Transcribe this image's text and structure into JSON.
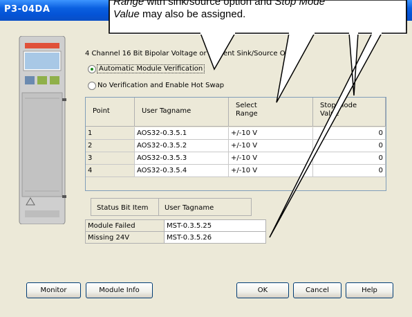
{
  "window": {
    "title": "P3-04DA"
  },
  "module_description": "4 Channel 16 Bit Bipolar Voltage or Current Sink/Source O",
  "verification": {
    "options": [
      {
        "label": "Automatic Module Verification",
        "selected": true
      },
      {
        "label": "No Verification and Enable Hot Swap",
        "selected": false
      }
    ]
  },
  "channels_table": {
    "columns": [
      "Point",
      "User Tagname",
      "Select\nRange",
      "Stop Mode\nValue"
    ],
    "rows": [
      {
        "point": "1",
        "tag": "AOS32-0.3.5.1",
        "range": "+/-10 V",
        "stop": "0"
      },
      {
        "point": "2",
        "tag": "AOS32-0.3.5.2",
        "range": "+/-10 V",
        "stop": "0"
      },
      {
        "point": "3",
        "tag": "AOS32-0.3.5.3",
        "range": "+/-10 V",
        "stop": "0"
      },
      {
        "point": "4",
        "tag": "AOS32-0.3.5.4",
        "range": "+/-10 V",
        "stop": "0"
      }
    ]
  },
  "status_table": {
    "columns": [
      "Status Bit Item",
      "User Tagname"
    ],
    "rows": [
      {
        "item": "Module Failed",
        "tag": "MST-0.3.5.25"
      },
      {
        "item": "Missing 24V",
        "tag": "MST-0.3.5.26"
      }
    ]
  },
  "buttons": {
    "monitor": "Monitor",
    "module_info": "Module Info",
    "ok": "OK",
    "cancel": "Cancel",
    "help": "Help"
  },
  "callout": {
    "line1_italic_a": "Range",
    "line1_rest": " with sink/source option and ",
    "line1_italic_b": "Stop Mode",
    "line2_italic": "Value",
    "line2_rest": " may also be assigned."
  },
  "colors": {
    "titlebar": "#0453d6",
    "dialog_bg": "#ece9d8",
    "grid_border": "#7f9db9",
    "radio_dot": "#1a8a1a"
  }
}
